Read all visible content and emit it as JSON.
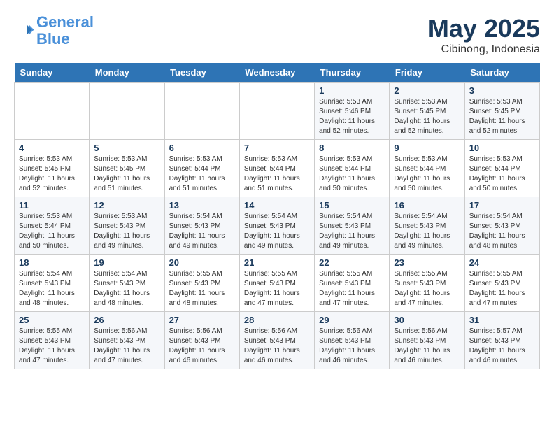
{
  "header": {
    "logo_line1": "General",
    "logo_line2": "Blue",
    "month": "May 2025",
    "location": "Cibinong, Indonesia"
  },
  "weekdays": [
    "Sunday",
    "Monday",
    "Tuesday",
    "Wednesday",
    "Thursday",
    "Friday",
    "Saturday"
  ],
  "weeks": [
    [
      {
        "num": "",
        "info": ""
      },
      {
        "num": "",
        "info": ""
      },
      {
        "num": "",
        "info": ""
      },
      {
        "num": "",
        "info": ""
      },
      {
        "num": "1",
        "info": "Sunrise: 5:53 AM\nSunset: 5:46 PM\nDaylight: 11 hours\nand 52 minutes."
      },
      {
        "num": "2",
        "info": "Sunrise: 5:53 AM\nSunset: 5:45 PM\nDaylight: 11 hours\nand 52 minutes."
      },
      {
        "num": "3",
        "info": "Sunrise: 5:53 AM\nSunset: 5:45 PM\nDaylight: 11 hours\nand 52 minutes."
      }
    ],
    [
      {
        "num": "4",
        "info": "Sunrise: 5:53 AM\nSunset: 5:45 PM\nDaylight: 11 hours\nand 52 minutes."
      },
      {
        "num": "5",
        "info": "Sunrise: 5:53 AM\nSunset: 5:45 PM\nDaylight: 11 hours\nand 51 minutes."
      },
      {
        "num": "6",
        "info": "Sunrise: 5:53 AM\nSunset: 5:44 PM\nDaylight: 11 hours\nand 51 minutes."
      },
      {
        "num": "7",
        "info": "Sunrise: 5:53 AM\nSunset: 5:44 PM\nDaylight: 11 hours\nand 51 minutes."
      },
      {
        "num": "8",
        "info": "Sunrise: 5:53 AM\nSunset: 5:44 PM\nDaylight: 11 hours\nand 50 minutes."
      },
      {
        "num": "9",
        "info": "Sunrise: 5:53 AM\nSunset: 5:44 PM\nDaylight: 11 hours\nand 50 minutes."
      },
      {
        "num": "10",
        "info": "Sunrise: 5:53 AM\nSunset: 5:44 PM\nDaylight: 11 hours\nand 50 minutes."
      }
    ],
    [
      {
        "num": "11",
        "info": "Sunrise: 5:53 AM\nSunset: 5:44 PM\nDaylight: 11 hours\nand 50 minutes."
      },
      {
        "num": "12",
        "info": "Sunrise: 5:53 AM\nSunset: 5:43 PM\nDaylight: 11 hours\nand 49 minutes."
      },
      {
        "num": "13",
        "info": "Sunrise: 5:54 AM\nSunset: 5:43 PM\nDaylight: 11 hours\nand 49 minutes."
      },
      {
        "num": "14",
        "info": "Sunrise: 5:54 AM\nSunset: 5:43 PM\nDaylight: 11 hours\nand 49 minutes."
      },
      {
        "num": "15",
        "info": "Sunrise: 5:54 AM\nSunset: 5:43 PM\nDaylight: 11 hours\nand 49 minutes."
      },
      {
        "num": "16",
        "info": "Sunrise: 5:54 AM\nSunset: 5:43 PM\nDaylight: 11 hours\nand 49 minutes."
      },
      {
        "num": "17",
        "info": "Sunrise: 5:54 AM\nSunset: 5:43 PM\nDaylight: 11 hours\nand 48 minutes."
      }
    ],
    [
      {
        "num": "18",
        "info": "Sunrise: 5:54 AM\nSunset: 5:43 PM\nDaylight: 11 hours\nand 48 minutes."
      },
      {
        "num": "19",
        "info": "Sunrise: 5:54 AM\nSunset: 5:43 PM\nDaylight: 11 hours\nand 48 minutes."
      },
      {
        "num": "20",
        "info": "Sunrise: 5:55 AM\nSunset: 5:43 PM\nDaylight: 11 hours\nand 48 minutes."
      },
      {
        "num": "21",
        "info": "Sunrise: 5:55 AM\nSunset: 5:43 PM\nDaylight: 11 hours\nand 47 minutes."
      },
      {
        "num": "22",
        "info": "Sunrise: 5:55 AM\nSunset: 5:43 PM\nDaylight: 11 hours\nand 47 minutes."
      },
      {
        "num": "23",
        "info": "Sunrise: 5:55 AM\nSunset: 5:43 PM\nDaylight: 11 hours\nand 47 minutes."
      },
      {
        "num": "24",
        "info": "Sunrise: 5:55 AM\nSunset: 5:43 PM\nDaylight: 11 hours\nand 47 minutes."
      }
    ],
    [
      {
        "num": "25",
        "info": "Sunrise: 5:55 AM\nSunset: 5:43 PM\nDaylight: 11 hours\nand 47 minutes."
      },
      {
        "num": "26",
        "info": "Sunrise: 5:56 AM\nSunset: 5:43 PM\nDaylight: 11 hours\nand 47 minutes."
      },
      {
        "num": "27",
        "info": "Sunrise: 5:56 AM\nSunset: 5:43 PM\nDaylight: 11 hours\nand 46 minutes."
      },
      {
        "num": "28",
        "info": "Sunrise: 5:56 AM\nSunset: 5:43 PM\nDaylight: 11 hours\nand 46 minutes."
      },
      {
        "num": "29",
        "info": "Sunrise: 5:56 AM\nSunset: 5:43 PM\nDaylight: 11 hours\nand 46 minutes."
      },
      {
        "num": "30",
        "info": "Sunrise: 5:56 AM\nSunset: 5:43 PM\nDaylight: 11 hours\nand 46 minutes."
      },
      {
        "num": "31",
        "info": "Sunrise: 5:57 AM\nSunset: 5:43 PM\nDaylight: 11 hours\nand 46 minutes."
      }
    ]
  ]
}
